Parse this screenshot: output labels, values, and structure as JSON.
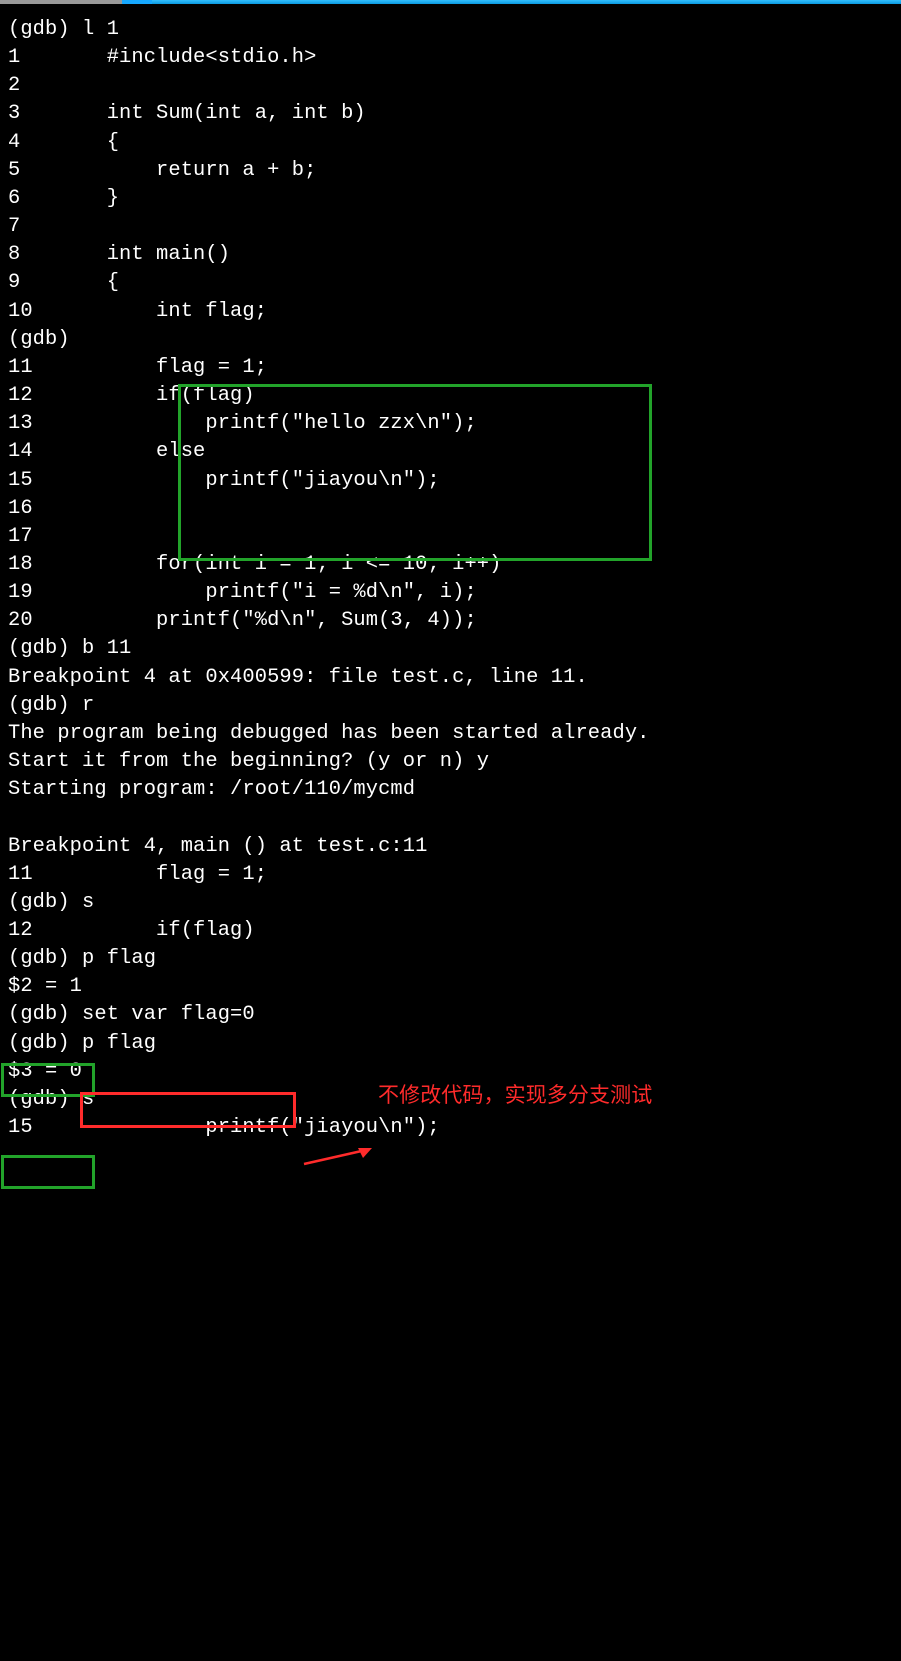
{
  "topbar": {
    "segments": [
      "gray",
      "cyan",
      "fill"
    ]
  },
  "terminal": {
    "lines": [
      "(gdb) l 1",
      "1       #include<stdio.h>",
      "2",
      "3       int Sum(int a, int b)",
      "4       {",
      "5           return a + b;",
      "6       }",
      "7",
      "8       int main()",
      "9       {",
      "10          int flag;",
      "(gdb) ",
      "11          flag = 1;",
      "12          if(flag)",
      "13              printf(\"hello zzx\\n\");",
      "14          else",
      "15              printf(\"jiayou\\n\");",
      "16",
      "17",
      "18          for(int i = 1; i <= 10; i++)",
      "19              printf(\"i = %d\\n\", i);",
      "20          printf(\"%d\\n\", Sum(3, 4));",
      "(gdb) b 11",
      "Breakpoint 4 at 0x400599: file test.c, line 11.",
      "(gdb) r",
      "The program being debugged has been started already.",
      "Start it from the beginning? (y or n) y",
      "Starting program: /root/110/mycmd ",
      "",
      "Breakpoint 4, main () at test.c:11",
      "11          flag = 1;",
      "(gdb) s",
      "12          if(flag)",
      "(gdb) p flag",
      "$2 = 1",
      "(gdb) set var flag=0",
      "(gdb) p flag",
      "$3 = 0",
      "(gdb) s",
      "15              printf(\"jiayou\\n\");"
    ]
  },
  "annotations": {
    "highlight_code_block": {
      "desc": "green box around lines 11-16 code",
      "color": "#22a32a"
    },
    "highlight_val1": {
      "text": "$2 = 1",
      "desc": "green box around first printed value",
      "color": "#22a32a"
    },
    "highlight_setvar": {
      "text": "set var flag=0",
      "desc": "red box around set var command",
      "color": "#ff2b2b"
    },
    "highlight_val2": {
      "text": "$3 = 0",
      "desc": "green box around second printed value",
      "color": "#22a32a"
    },
    "arrow_label": "不修改代码，实现多分支测试"
  }
}
